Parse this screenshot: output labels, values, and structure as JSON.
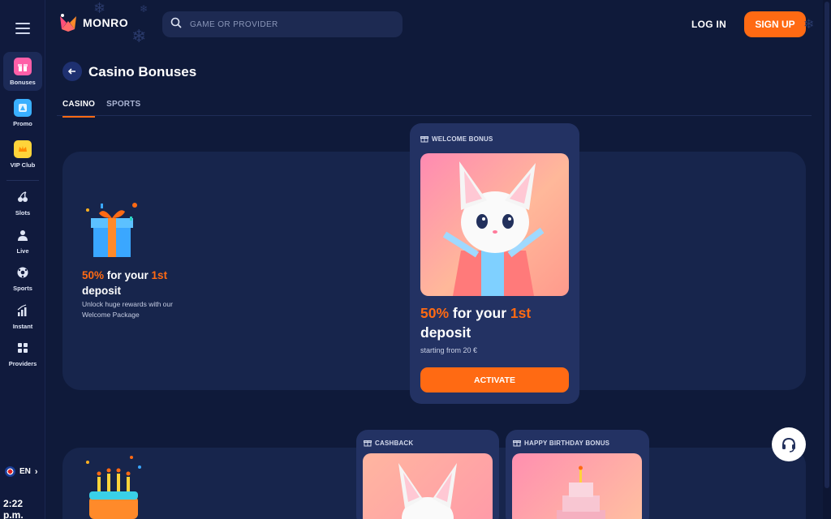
{
  "app": {
    "brand": "MONRO",
    "accent": "#ff6a13"
  },
  "header": {
    "search_placeholder": "GAME OR PROVIDER",
    "login_label": "LOG IN",
    "signup_label": "SIGN UP"
  },
  "sidebar": {
    "items": [
      {
        "label": "Bonuses",
        "icon": "gift-icon"
      },
      {
        "label": "Promo",
        "icon": "promo-icon"
      },
      {
        "label": "VIP Club",
        "icon": "crown-icon"
      },
      {
        "label": "Slots",
        "icon": "cherry-icon"
      },
      {
        "label": "Live",
        "icon": "dealer-icon"
      },
      {
        "label": "Sports",
        "icon": "ball-icon"
      },
      {
        "label": "Instant",
        "icon": "chart-icon"
      },
      {
        "label": "Providers",
        "icon": "grid-icon"
      }
    ],
    "language": "EN",
    "time": "2:22 p.m."
  },
  "page": {
    "title": "Casino Bonuses",
    "tabs": [
      {
        "label": "CASINO"
      },
      {
        "label": "SPORTS"
      }
    ]
  },
  "banner1": {
    "title_pct": "50%",
    "title_mid": " for your ",
    "title_ord": "1st",
    "title_end": " deposit",
    "desc": "Unlock huge rewards with our Welcome Package"
  },
  "welcome_card": {
    "tag": "WELCOME BONUS",
    "title_pct": "50%",
    "title_mid": " for your ",
    "title_ord": "1st",
    "title_end": " deposit",
    "sub": "starting from 20 €",
    "button": "ACTIVATE"
  },
  "cashback_card": {
    "tag": "CASHBACK"
  },
  "birthday_card": {
    "tag": "HAPPY BIRTHDAY BONUS"
  }
}
